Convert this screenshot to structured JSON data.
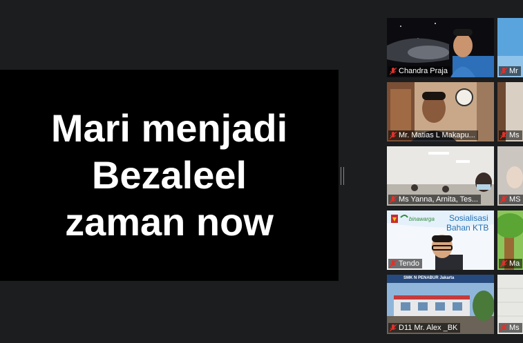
{
  "slide": {
    "lines": [
      "Mari menjadi",
      "Bezaleel",
      "zaman now"
    ]
  },
  "gallery": {
    "tiles": [
      {
        "name": "Chandra Praja"
      },
      {
        "name": "Mr"
      },
      {
        "name": "Mr. Matias L Makapu..."
      },
      {
        "name": "Ms"
      },
      {
        "name": "Ms Yanna, Arnita, Tes..."
      },
      {
        "name": "MS"
      },
      {
        "name": "Tendo"
      },
      {
        "name": "Ma"
      },
      {
        "name": "D11 Mr. Alex _BK"
      },
      {
        "name": "Ms"
      }
    ],
    "sosialisasi": {
      "brand": "binawarga",
      "title_line1": "Sosialisasi",
      "title_line2": "Bahan KTB"
    },
    "school_banner": "SMK N PENABUR Jakarta"
  },
  "colors": {
    "muted_mic": "#e0312b",
    "background": "#1b1d1f"
  }
}
